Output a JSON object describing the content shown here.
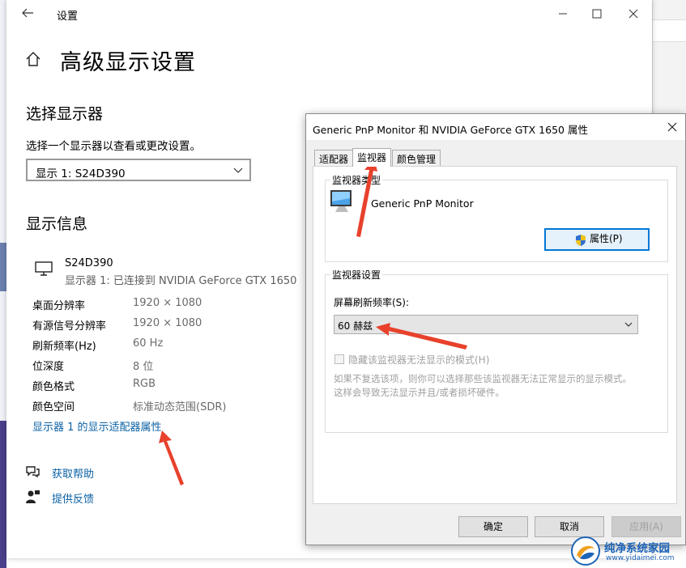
{
  "settings": {
    "window_title": "设置",
    "page_title": "高级显示设置",
    "select_display": {
      "heading": "选择显示器",
      "description": "选择一个显示器以查看或更改设置。",
      "selected": "显示 1: S24D390"
    },
    "display_info": {
      "heading": "显示信息",
      "monitor_name": "S24D390",
      "monitor_sub": "显示器 1: 已连接到 NVIDIA GeForce GTX 1650",
      "rows": [
        {
          "key": "桌面分辨率",
          "value": "1920 × 1080"
        },
        {
          "key": "有源信号分辨率",
          "value": "1920 × 1080"
        },
        {
          "key": "刷新频率(Hz)",
          "value": "60 Hz"
        },
        {
          "key": "位深度",
          "value": "8 位"
        },
        {
          "key": "颜色格式",
          "value": "RGB"
        },
        {
          "key": "颜色空间",
          "value": "标准动态范围(SDR)"
        }
      ],
      "adapter_link": "显示器 1 的显示适配器属性"
    },
    "help": {
      "get_help": "获取帮助",
      "feedback": "提供反馈"
    }
  },
  "dialog": {
    "title": "Generic PnP Monitor 和 NVIDIA GeForce GTX 1650 属性",
    "tabs": [
      "适配器",
      "监视器",
      "颜色管理"
    ],
    "active_tab": 1,
    "monitor_type": {
      "legend": "监视器类型",
      "name": "Generic PnP Monitor",
      "properties_button": "属性(P)"
    },
    "monitor_settings": {
      "legend": "监视器设置",
      "refresh_label": "屏幕刷新频率(S):",
      "refresh_value": "60 赫兹",
      "hide_modes_label": "隐藏该监视器无法显示的模式(H)",
      "note_line1": "如果不复选该项，则你可以选择那些该监视器无法正常显示的显示模式。",
      "note_line2": "这样会导致无法显示并且/或者损坏硬件。"
    },
    "buttons": {
      "ok": "确定",
      "cancel": "取消",
      "apply": "应用(A)"
    }
  },
  "watermark": {
    "title": "纯净系统家园",
    "url": "www.yidaimei.com"
  },
  "colors": {
    "link": "#0b61a4",
    "arrow": "#e8412c",
    "focus": "#0078d7"
  }
}
